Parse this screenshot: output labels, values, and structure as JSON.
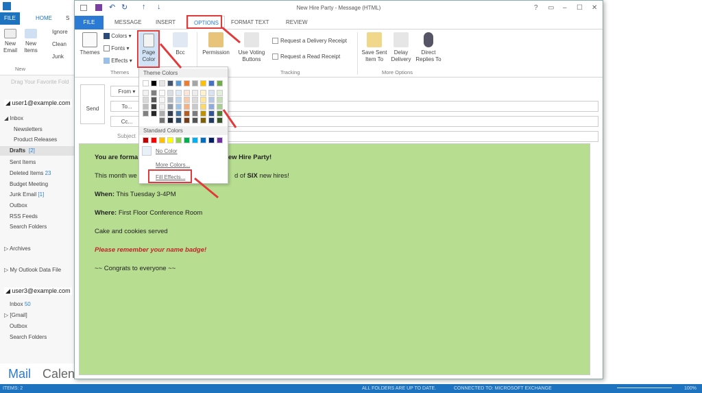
{
  "main_window": {
    "tabs": [
      "FILE",
      "HOME",
      "S"
    ],
    "ribbon": {
      "new_email": "New Email",
      "new_items": "New Items",
      "ignore": "Ignore",
      "clean_up": "Clean",
      "junk": "Junk",
      "group_new": "New"
    },
    "favorites_hint": "Drag Your Favorite Fold",
    "accounts": [
      {
        "name": "user1@example.com",
        "folders": [
          {
            "label": "Inbox"
          },
          {
            "label": "Newsletters"
          },
          {
            "label": "Product Releases"
          },
          {
            "label": "Drafts",
            "count": "[2]"
          },
          {
            "label": "Sent Items"
          },
          {
            "label": "Deleted Items",
            "count": "23"
          },
          {
            "label": "Budget Meeting"
          },
          {
            "label": "Junk Email",
            "count": "[1]"
          },
          {
            "label": "Outbox"
          },
          {
            "label": "RSS Feeds"
          },
          {
            "label": "Search Folders"
          }
        ]
      },
      {
        "name": "user3@example.com",
        "folders": [
          {
            "label": "Inbox",
            "count": "50"
          },
          {
            "label": "[Gmail]"
          },
          {
            "label": "Outbox"
          },
          {
            "label": "Search Folders"
          }
        ]
      }
    ],
    "other_folders": [
      "Archives",
      "My Outlook Data File"
    ],
    "bottom_nav": [
      "Mail",
      "Calen"
    ],
    "status": {
      "items": "ITEMS: 2",
      "sync": "ALL FOLDERS ARE UP TO DATE.",
      "connection": "CONNECTED TO: MICROSOFT EXCHANGE",
      "zoom": "100%"
    }
  },
  "message_window": {
    "title": "New Hire Party - Message (HTML)",
    "window_controls": [
      "?",
      "▭",
      "–",
      "☐",
      "✕"
    ],
    "tabs": [
      "FILE",
      "MESSAGE",
      "INSERT",
      "OPTIONS",
      "FORMAT TEXT",
      "REVIEW"
    ],
    "active_tab": "OPTIONS",
    "ribbon": {
      "themes": "Themes",
      "colors": "Colors",
      "fonts": "Fonts",
      "effects": "Effects",
      "page_color": "Page Color",
      "bcc": "Bcc",
      "group_themes": "Themes",
      "permission": "Permission",
      "voting": "Use Voting Buttons",
      "delivery_receipt": "Request a Delivery Receipt",
      "read_receipt": "Request a Read Receipt",
      "group_tracking": "Tracking",
      "save_sent": "Save Sent Item To",
      "delay": "Delay Delivery",
      "direct": "Direct Replies To",
      "group_more": "More Options"
    },
    "header": {
      "send": "Send",
      "from": "From",
      "to": "To...",
      "cc": "Cc...",
      "subject": "Subject"
    },
    "body": {
      "line1a": "You are forma",
      "line1b": "New Hire Party!",
      "line2a": "This month we",
      "line2b": "d of ",
      "line2c": "SIX",
      "line2d": " new hires!",
      "when_label": "When:",
      "when": " This Tuesday 3-4PM",
      "where_label": "Where:",
      "where": "  First Floor Conference Room",
      "cake": "Cake and cookies served",
      "reminder": "Please remember your name badge!",
      "congrats": "~~ Congrats to everyone  ~~",
      "page_color": "#b7dd91"
    },
    "page_color_menu": {
      "theme_header": "Theme Colors",
      "theme_colors": [
        "#ffffff",
        "#000000",
        "#e7e6e6",
        "#44546a",
        "#5b9bd5",
        "#ed7d31",
        "#a5a5a5",
        "#ffc000",
        "#4472c4",
        "#70ad47"
      ],
      "standard_header": "Standard Colors",
      "standard_colors": [
        "#c00000",
        "#ff0000",
        "#ffc000",
        "#ffff00",
        "#92d050",
        "#00b050",
        "#00b0f0",
        "#0070c0",
        "#002060",
        "#7030a0"
      ],
      "no_color": "No Color",
      "more_colors": "More Colors...",
      "fill_effects": "Fill Effects..."
    }
  },
  "colors": {
    "accent": "#2b7ad4",
    "annotation": "#e23a3a",
    "statusbar": "#1e73be"
  }
}
